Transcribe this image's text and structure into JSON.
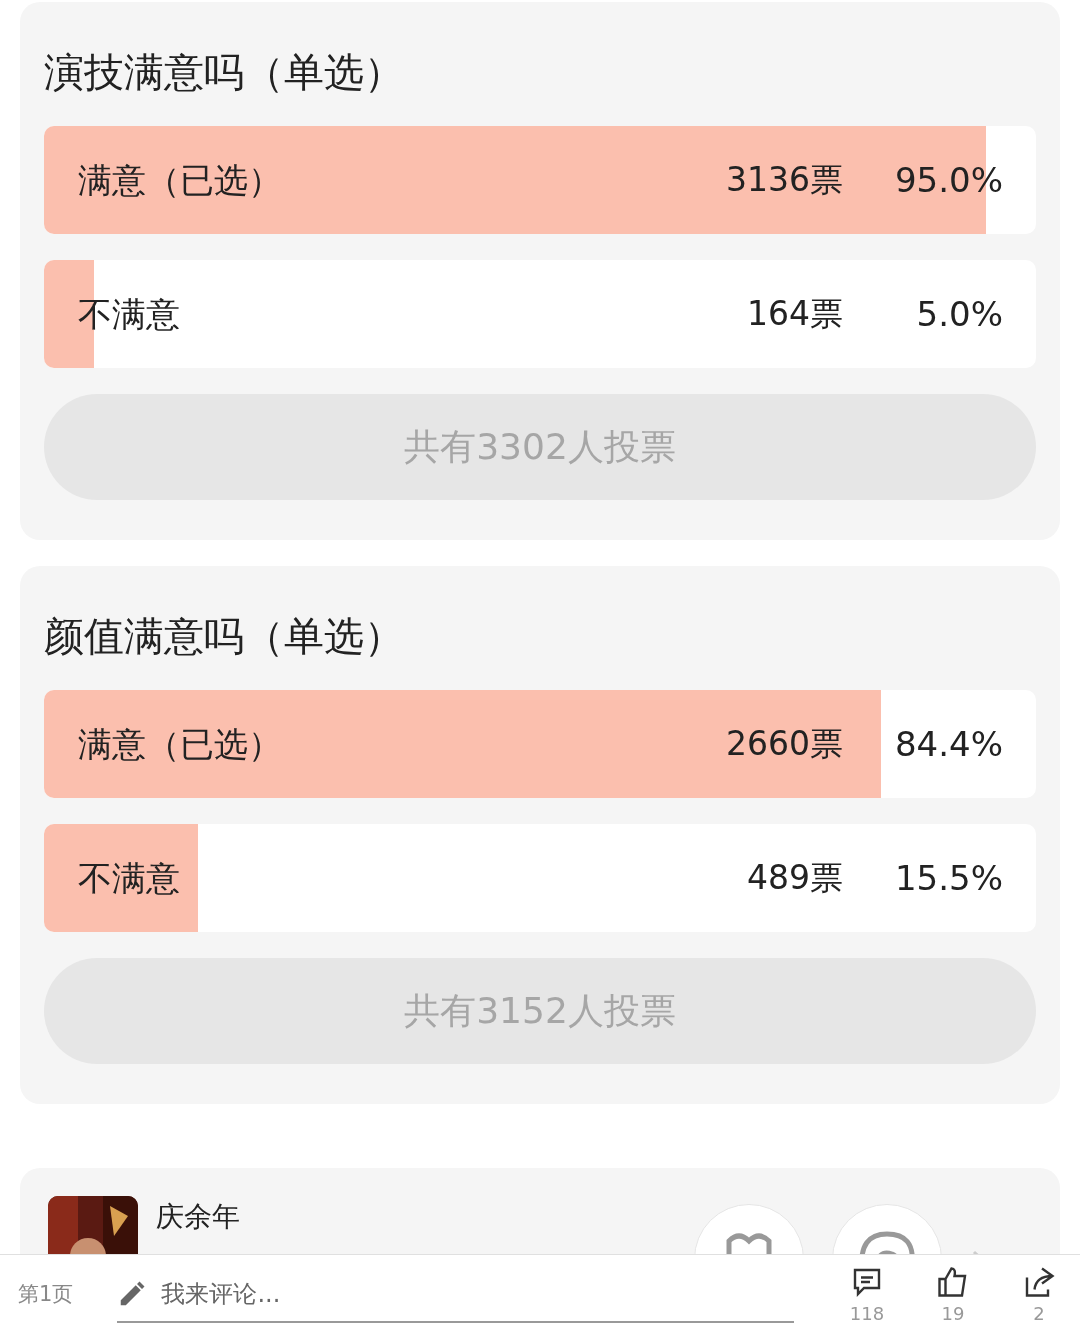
{
  "polls": [
    {
      "title": "演技满意吗（单选）",
      "options": [
        {
          "label": "满意（已选）",
          "votes": "3136票",
          "percent": "95.0%",
          "level": 0.95
        },
        {
          "label": "不满意",
          "votes": "164票",
          "percent": "5.0%",
          "level": 0.05
        }
      ],
      "total": "共有3302人投票"
    },
    {
      "title": "颜值满意吗（单选）",
      "options": [
        {
          "label": "满意（已选）",
          "votes": "2660票",
          "percent": "84.4%",
          "level": 0.844
        },
        {
          "label": "不满意",
          "votes": "489票",
          "percent": "15.5%",
          "level": 0.155
        }
      ],
      "total": "共有3152人投票"
    }
  ],
  "show_card": {
    "title": "庆余年"
  },
  "bottom_bar": {
    "page": "第1页",
    "comment_placeholder": "我来评论...",
    "comments": "118",
    "likes": "19",
    "shares": "2"
  }
}
